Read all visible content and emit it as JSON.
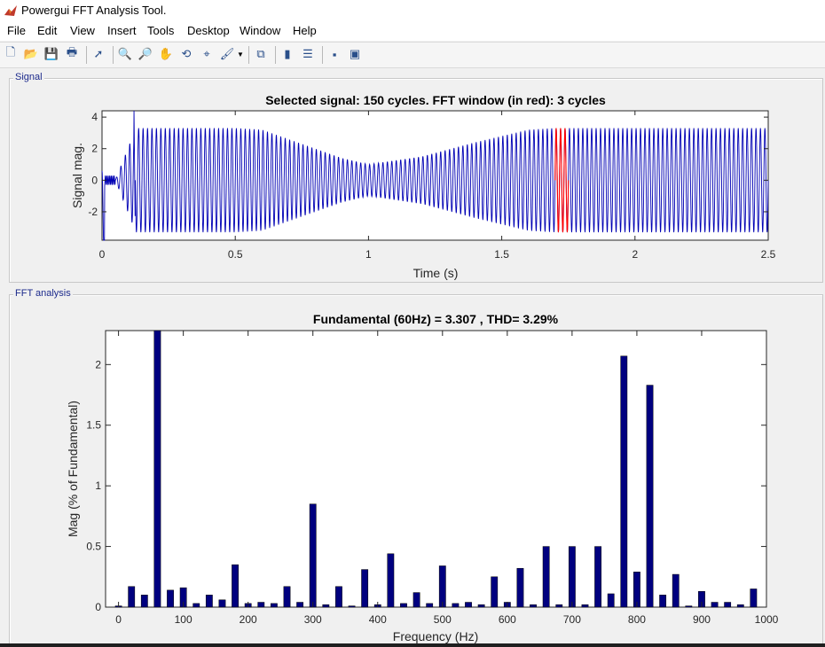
{
  "window": {
    "title": "Powergui FFT Analysis Tool."
  },
  "menu": [
    "File",
    "Edit",
    "View",
    "Insert",
    "Tools",
    "Desktop",
    "Window",
    "Help"
  ],
  "toolbar": [
    {
      "name": "new-file-icon",
      "glyph": "🗋"
    },
    {
      "name": "open-folder-icon",
      "glyph": "📂"
    },
    {
      "name": "save-icon",
      "glyph": "💾"
    },
    {
      "name": "print-icon",
      "glyph": "🖶"
    },
    {
      "name": "separator"
    },
    {
      "name": "pointer-icon",
      "glyph": "➚"
    },
    {
      "name": "separator"
    },
    {
      "name": "zoom-in-icon",
      "glyph": "🔍"
    },
    {
      "name": "zoom-out-icon",
      "glyph": "🔎"
    },
    {
      "name": "pan-hand-icon",
      "glyph": "✋"
    },
    {
      "name": "rotate-3d-icon",
      "glyph": "⟲"
    },
    {
      "name": "data-cursor-icon",
      "glyph": "⌖"
    },
    {
      "name": "brush-icon",
      "glyph": "🖌"
    },
    {
      "name": "separator"
    },
    {
      "name": "link-plot-icon",
      "glyph": "⧉"
    },
    {
      "name": "separator"
    },
    {
      "name": "colorbar-icon",
      "glyph": "▮"
    },
    {
      "name": "legend-icon",
      "glyph": "☰"
    },
    {
      "name": "separator"
    },
    {
      "name": "hide-plot-tools-icon",
      "glyph": "▪"
    },
    {
      "name": "show-plot-tools-icon",
      "glyph": "▣"
    }
  ],
  "panels": {
    "signal": "Signal",
    "fft": "FFT analysis"
  },
  "chart_data": [
    {
      "type": "line",
      "title": "Selected signal: 150 cycles. FFT window (in red): 3 cycles",
      "xlabel": "Time (s)",
      "ylabel": "Signal mag.",
      "xlim": [
        0,
        2.5
      ],
      "ylim": [
        -3.8,
        4.4
      ],
      "xticks": [
        0,
        0.5,
        1,
        1.5,
        2,
        2.5
      ],
      "xticklabels": [
        "0",
        "0.5",
        "1",
        "1.5",
        "2",
        "2.5"
      ],
      "yticks": [
        -2,
        0,
        2,
        4
      ],
      "yticklabels": [
        "-2",
        "0",
        "2",
        "4"
      ],
      "fundamental_hz": 60,
      "envelope": {
        "t": [
          0.12,
          0.5,
          0.6,
          0.8,
          0.9,
          1.0,
          1.2,
          1.4,
          1.6,
          1.7,
          2.5
        ],
        "amp": [
          3.3,
          3.3,
          3.2,
          2.0,
          1.4,
          1.0,
          1.5,
          2.4,
          3.2,
          3.3,
          3.3
        ]
      },
      "fft_window": {
        "start": 1.7,
        "end": 1.75,
        "color": "#ff0000"
      },
      "series_color": "#0000b4",
      "grid": false
    },
    {
      "type": "bar",
      "title": "Fundamental (60Hz) = 3.307 , THD= 3.29%",
      "xlabel": "Frequency (Hz)",
      "ylabel": "Mag (% of Fundamental)",
      "xlim": [
        -20,
        1000
      ],
      "ylim": [
        0,
        2.28
      ],
      "xticks": [
        0,
        100,
        200,
        300,
        400,
        500,
        600,
        700,
        800,
        900,
        1000
      ],
      "xticklabels": [
        "0",
        "100",
        "200",
        "300",
        "400",
        "500",
        "600",
        "700",
        "800",
        "900",
        "1000"
      ],
      "yticks": [
        0,
        0.5,
        1,
        1.5,
        2
      ],
      "yticklabels": [
        "0",
        "0.5",
        "1",
        "1.5",
        "2"
      ],
      "x": [
        0,
        20,
        40,
        60,
        80,
        100,
        120,
        140,
        160,
        180,
        200,
        220,
        240,
        260,
        280,
        300,
        320,
        340,
        360,
        380,
        400,
        420,
        440,
        460,
        480,
        500,
        520,
        540,
        560,
        580,
        600,
        620,
        640,
        660,
        680,
        700,
        720,
        740,
        760,
        780,
        800,
        820,
        840,
        860,
        880,
        900,
        920,
        940,
        960,
        980
      ],
      "values": [
        0.01,
        0.17,
        0.1,
        2.28,
        0.14,
        0.16,
        0.03,
        0.1,
        0.06,
        0.35,
        0.03,
        0.04,
        0.03,
        0.17,
        0.04,
        0.85,
        0.02,
        0.17,
        0.01,
        0.31,
        0.02,
        0.44,
        0.03,
        0.12,
        0.03,
        0.34,
        0.03,
        0.04,
        0.02,
        0.25,
        0.04,
        0.32,
        0.02,
        0.5,
        0.02,
        0.5,
        0.02,
        0.5,
        0.11,
        2.07,
        0.29,
        1.83,
        0.1,
        0.27,
        0.01,
        0.13,
        0.04,
        0.04,
        0.02,
        0.15
      ],
      "bar_color": "#00007f",
      "grid": false
    }
  ]
}
